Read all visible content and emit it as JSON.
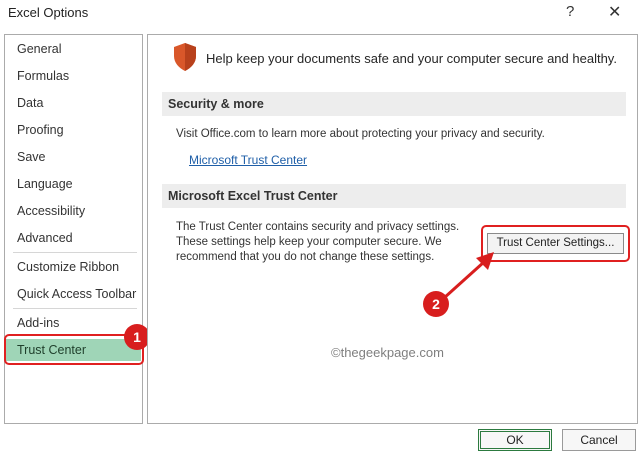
{
  "window": {
    "title": "Excel Options",
    "help_label": "?",
    "close_label": "✕"
  },
  "sidebar": {
    "items": [
      {
        "label": "General"
      },
      {
        "label": "Formulas"
      },
      {
        "label": "Data"
      },
      {
        "label": "Proofing"
      },
      {
        "label": "Save"
      },
      {
        "label": "Language"
      },
      {
        "label": "Accessibility"
      },
      {
        "label": "Advanced"
      },
      {
        "label": "Customize Ribbon"
      },
      {
        "label": "Quick Access Toolbar"
      },
      {
        "label": "Add-ins"
      },
      {
        "label": "Trust Center",
        "selected": true
      }
    ]
  },
  "main": {
    "headline": "Help keep your documents safe and your computer secure and healthy.",
    "security_section": {
      "heading": "Security & more",
      "text": "Visit Office.com to learn more about protecting your privacy and security.",
      "link_label": "Microsoft Trust Center"
    },
    "trust_section": {
      "heading": "Microsoft Excel Trust Center",
      "line1": "The Trust Center contains security and privacy settings.",
      "line2": "These settings help keep your computer secure. We",
      "line3": "recommend that you do not change these settings.",
      "button_label": "Trust Center Settings..."
    },
    "watermark": "©thegeekpage.com"
  },
  "annotations": {
    "badge1": "1",
    "badge2": "2"
  },
  "footer": {
    "ok_label": "OK",
    "cancel_label": "Cancel"
  },
  "colors": {
    "selected_item_bg": "#9fd5b7",
    "annotation_red": "#d81e1e",
    "shield_orange": "#d9572a",
    "link_blue": "#1f5fa8"
  }
}
